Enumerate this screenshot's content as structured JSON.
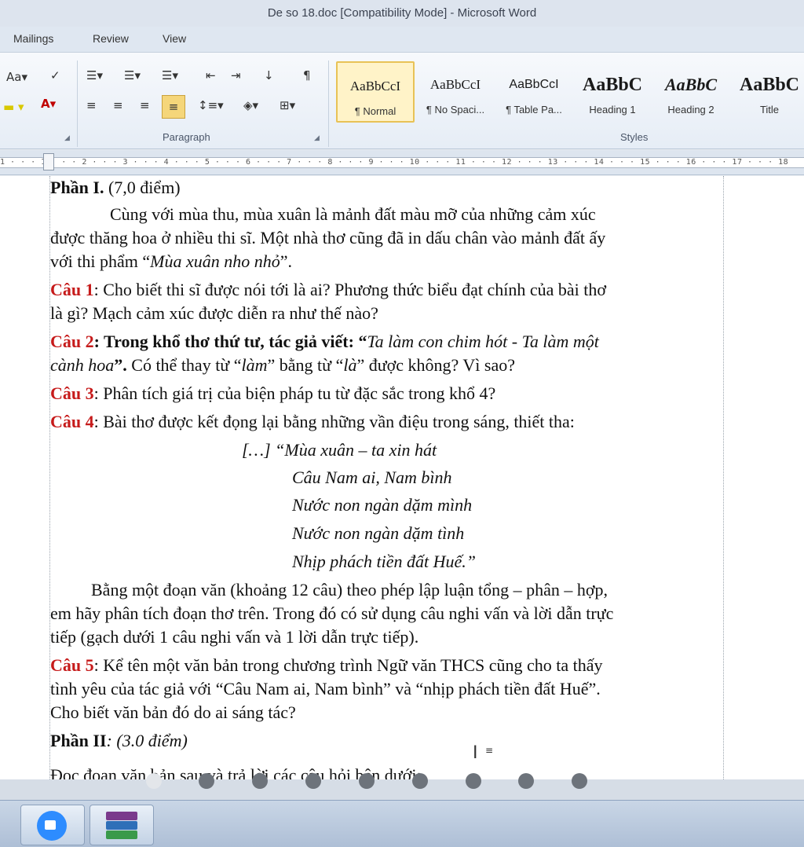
{
  "window": {
    "title": "De so 18.doc [Compatibility Mode]  -  Microsoft Word"
  },
  "tabs": [
    "Mailings",
    "Review",
    "View"
  ],
  "ribbon": {
    "paragraph_label": "Paragraph",
    "styles_label": "Styles",
    "styles": [
      {
        "sample": "AaBbCcI",
        "name": "¶ Normal",
        "active": true
      },
      {
        "sample": "AaBbCcI",
        "name": "¶ No Spaci..."
      },
      {
        "sample": "AaBbCcI",
        "name": "¶ Table Pa..."
      },
      {
        "sample": "AaBbC",
        "name": "Heading 1"
      },
      {
        "sample": "AaBbC",
        "name": "Heading 2"
      },
      {
        "sample": "AaBbC",
        "name": "Title"
      }
    ],
    "font_size_icon": "Aa"
  },
  "ruler": {
    "numbers": "1 · · · 1 · · · 2 · · · 3 · · · 4 · · · 5 · · · 6 · · · 7 · · · 8 · · · 9 · · · 10 · · · 11 · · · 12 · · · 13 · · · 14 · · · 15 · · · 16 · · · 17 · · · 18"
  },
  "doc": {
    "part1_title": "Phần I.",
    "part1_points": " (7,0 điểm)",
    "intro_1": "Cùng với mùa thu, mùa xuân là mảnh đất màu mỡ của những cảm xúc",
    "intro_2": "được thăng hoa ở nhiều thi sĩ. Một nhà thơ cũng đã in dấu chân vào mảnh đất ấy",
    "intro_3a": "với thi phẩm “",
    "intro_3b": "Mùa xuân nho nhỏ",
    "intro_3c": "”.",
    "q1_label": "Câu 1",
    "q1_line1": ": Cho biết thi sĩ được nói tới là ai? Phương thức biểu đạt chính của bài thơ",
    "q1_line2": "là gì? Mạch cảm xúc được diễn ra như thế nào?",
    "q2_label": "Câu 2",
    "q2_line1a": ": Trong khổ thơ thứ tư, tác giả viết: ",
    "q2_line1b": "“",
    "q2_line1c": "Ta làm con chim hót - Ta làm một",
    "q2_line2a": "cành hoa",
    "q2_line2b": "”. ",
    "q2_line2c": "Có thể thay từ “",
    "q2_line2d": "làm",
    "q2_line2e": "” bằng từ “",
    "q2_line2f": "là",
    "q2_line2g": "” được không? Vì sao?",
    "q3_label": "Câu 3",
    "q3_line1": ": Phân tích giá trị của biện pháp tu từ đặc sắc trong khổ 4?",
    "q4_label": "Câu 4",
    "q4_line1": ": Bài thơ được kết đọng lại bằng những vần điệu trong sáng, thiết tha:",
    "poem_1": "[…] “Mùa xuân – ta xin hát",
    "poem_2": "Câu Nam ai, Nam bình",
    "poem_3": "Nước non ngàn dặm mình",
    "poem_4": "Nước non ngàn dặm tình",
    "poem_5": "Nhịp phách tiền đất Huế.”",
    "task_1": "Bằng một đoạn văn (khoảng 12 câu) theo phép lập luận tổng – phân – hợp,",
    "task_2": "em hãy phân tích đoạn thơ trên. Trong đó có sử dụng câu nghi vấn và lời dẫn trực",
    "task_3": "tiếp (gạch dưới 1 câu nghi vấn và 1 lời dẫn trực tiếp).",
    "q5_label": "Câu 5",
    "q5_line1": ": Kể tên một văn bản trong chương trình Ngữ văn THCS cũng cho ta thấy",
    "q5_line2": "tình yêu của tác giả với “Câu Nam ai, Nam bình” và “nhịp phách tiền đất Huế”.",
    "q5_line3": "Cho biết văn bản đó do ai sáng tác?",
    "part2_title": "Phần II",
    "part2_points": ": (3.0 điểm)",
    "last_line": "Đọc đoạn văn bản sau và trả lời các câu hỏi bên dưới:"
  },
  "colors": {
    "question_red": "#c61b1b",
    "active_style": "#fff3c8"
  },
  "taskbar": {
    "items": [
      {
        "icon": "zoom-icon"
      },
      {
        "icon": "winrar-icon"
      }
    ]
  }
}
